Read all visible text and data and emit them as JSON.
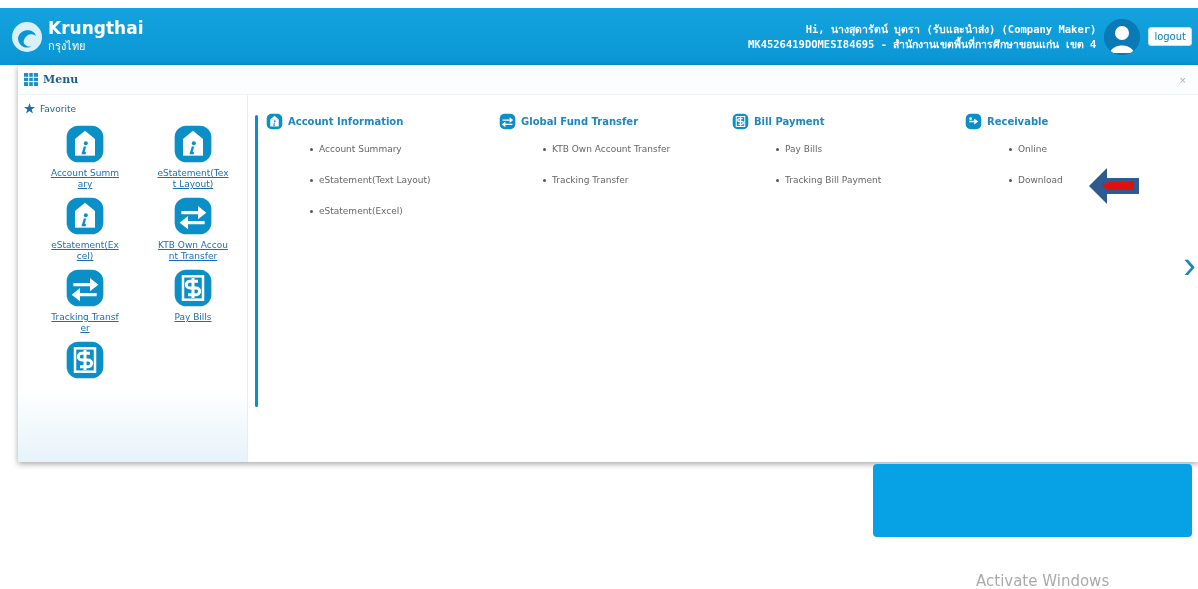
{
  "header": {
    "logo_name": "Krungthai",
    "logo_subname": "กรุงไทย",
    "greeting": "Hi, นางสุดารัตน์ บุตรา (รับและนำส่ง) (Company Maker)",
    "account_line": "MK4526419DOMESI84695 - สำนักงานเขตพื้นที่การศึกษาขอนแก่น เขต 4",
    "logout": "logout"
  },
  "menu": {
    "title": "Menu",
    "close": "×",
    "favorites_title": "Favorite",
    "favorites": [
      {
        "kind": "info",
        "label": "Account Summary"
      },
      {
        "kind": "info",
        "label": "eStatement(Text Layout)"
      },
      {
        "kind": "info",
        "label": "eStatement(Excel)"
      },
      {
        "kind": "transfer",
        "label": "KTB Own Account Transfer"
      },
      {
        "kind": "transfer",
        "label": "Tracking Transfer"
      },
      {
        "kind": "dollar",
        "label": "Pay Bills"
      },
      {
        "kind": "dollar"
      }
    ],
    "sections": [
      {
        "kind": "info",
        "title": "Account Information",
        "items": [
          "Account Summary",
          "eStatement(Text Layout)",
          "eStatement(Excel)"
        ]
      },
      {
        "kind": "transfer",
        "title": "Global Fund Transfer",
        "items": [
          "KTB Own Account Transfer",
          "Tracking Transfer"
        ]
      },
      {
        "kind": "dollar",
        "title": "Bill Payment",
        "items": [
          "Pay Bills",
          "Tracking Bill Payment"
        ]
      },
      {
        "kind": "receivable",
        "title": "Receivable",
        "items": [
          "Online",
          "Download"
        ]
      }
    ],
    "next": "›"
  },
  "os_notice": "Activate Windows"
}
